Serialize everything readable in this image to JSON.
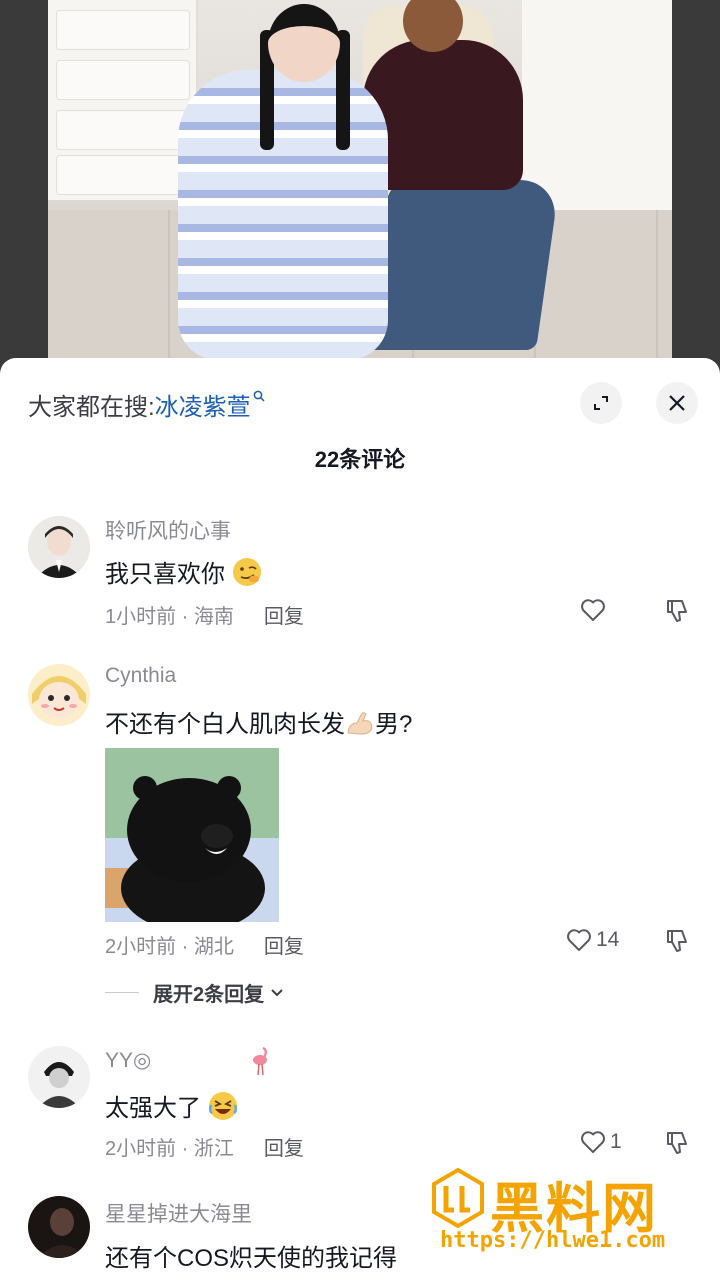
{
  "search": {
    "prefix": "大家都在搜:",
    "term": "冰凌紫萱"
  },
  "comment_count": "22条评论",
  "comments": [
    {
      "username": "聆听风的心事",
      "content": "我只喜欢你",
      "time_location": "1小时前 · 海南",
      "reply": "回复",
      "likes": ""
    },
    {
      "username": "Cynthia",
      "content_before": "不还有个白人肌肉长发",
      "content_after": "男?",
      "time_location": "2小时前 · 湖北",
      "reply": "回复",
      "likes": "14",
      "expand_replies": "展开2条回复"
    },
    {
      "username": "YY◎",
      "content": "太强大了",
      "time_location": "2小时前 · 浙江",
      "reply": "回复",
      "likes": "1"
    },
    {
      "username": "星星掉进大海里",
      "content": "还有个COS炽天使的我记得"
    }
  ],
  "watermark": {
    "title": "黑料网",
    "url": "https://hlwe1.com"
  },
  "colors": {
    "search_term": "#1d5fb4",
    "watermark": "#f5a300",
    "meta_text": "#8a8b91"
  }
}
